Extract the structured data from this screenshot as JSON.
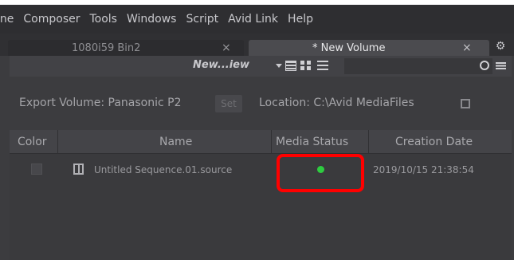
{
  "menu": {
    "items": [
      {
        "label": "ine"
      },
      {
        "label": "Composer"
      },
      {
        "label": "Tools"
      },
      {
        "label": "Windows"
      },
      {
        "label": "Script"
      },
      {
        "label": "Avid Link"
      },
      {
        "label": "Help"
      }
    ]
  },
  "tabs": [
    {
      "label": "1080i59 Bin2",
      "close": "×",
      "active": false
    },
    {
      "label": "* New Volume",
      "close": "×",
      "active": true
    }
  ],
  "toolbar": {
    "bin_title": "New...iew",
    "icons": [
      "dropdown-arrow",
      "text-view-icon",
      "frame-view-icon",
      "list-view-icon",
      "search-icon",
      "hamburger-menu-icon"
    ]
  },
  "export": {
    "volume_label": "Export Volume: Panasonic P2",
    "set_label": "Set",
    "location_label": "Location: C:\\Avid MediaFiles"
  },
  "table": {
    "columns": [
      "Color",
      "Name",
      "Media Status",
      "Creation Date"
    ],
    "rows": [
      {
        "name": "Untitled Sequence.01.source",
        "media_status_color": "#2ecc40",
        "creation_date": "2019/10/15 21:38:54"
      }
    ]
  },
  "colors": {
    "accent_highlight": "#ff0000",
    "status_online": "#2ecc40"
  }
}
